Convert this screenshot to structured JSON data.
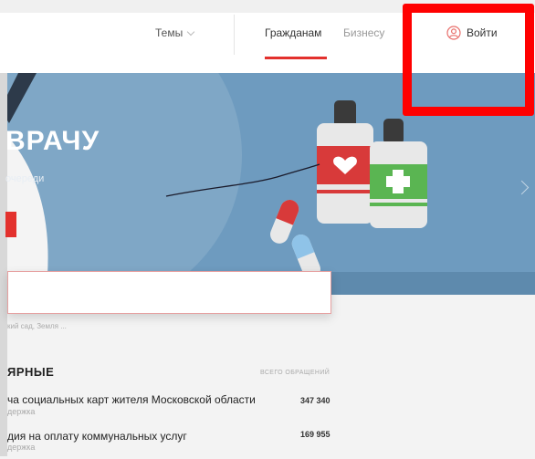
{
  "header": {
    "topics_label": "Темы",
    "tabs": [
      {
        "label": "Гражданам",
        "active": true
      },
      {
        "label": "Бизнесу",
        "active": false
      }
    ],
    "login_label": "Войти"
  },
  "hero": {
    "title": "ВРАЧУ",
    "subtitle": "очереди"
  },
  "search": {
    "value": "",
    "hint": "кий сад, Земля ..."
  },
  "popular": {
    "title": "ЯРНЫЕ",
    "count_label": "ВСЕГО ОБРАЩЕНИЙ",
    "items": [
      {
        "title": "ча социальных карт жителя Московской области",
        "sub": "держка",
        "count": "347 340"
      },
      {
        "title": "дия на оплату коммунальных услуг",
        "sub": "держка",
        "count": "169 955"
      }
    ]
  },
  "colors": {
    "accent": "#e3312d",
    "hero_bg": "#6e9bbf",
    "highlight_box": "#ff0000"
  }
}
